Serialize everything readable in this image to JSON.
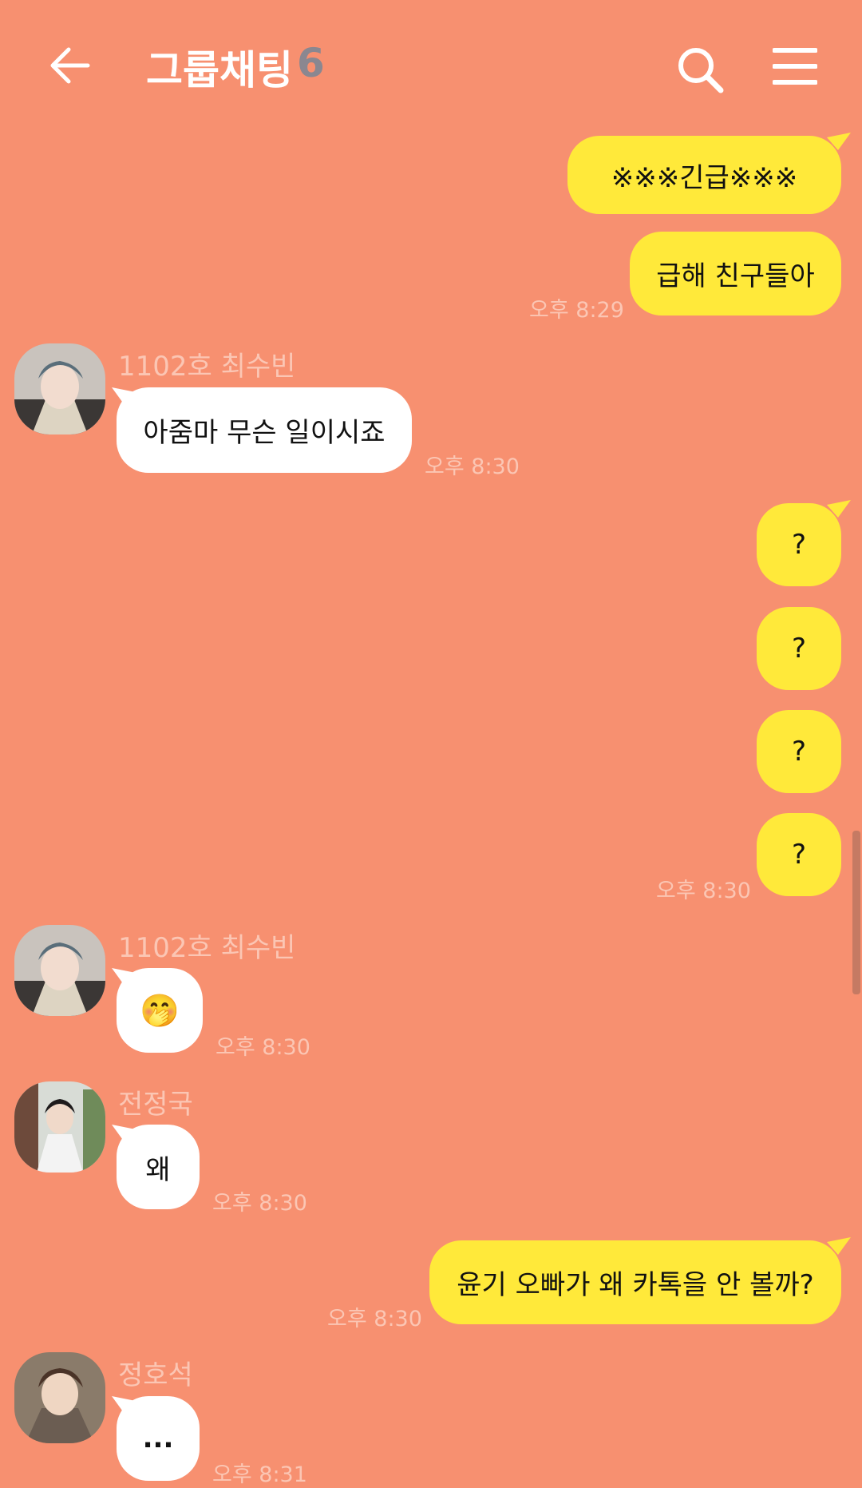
{
  "header": {
    "title": "그룹채팅",
    "member_count": "6",
    "icons": {
      "back": "arrow-left-icon",
      "search": "search-icon",
      "menu": "hamburger-menu-icon"
    }
  },
  "colors": {
    "background": "#f79070",
    "my_bubble": "#ffe93a",
    "their_bubble": "#ffffff",
    "timestamp": "#fbc6b4"
  },
  "messages": [
    {
      "from": "me",
      "text": "※※※긴급※※※"
    },
    {
      "from": "me",
      "text": "급해 친구들아",
      "time": "오후 8:29"
    },
    {
      "from": "1102호 최수빈",
      "text": "아줌마 무슨 일이시죠",
      "time": "오후 8:30"
    },
    {
      "from": "me",
      "text": "?"
    },
    {
      "from": "me",
      "text": "?"
    },
    {
      "from": "me",
      "text": "?"
    },
    {
      "from": "me",
      "text": "?",
      "time": "오후 8:30"
    },
    {
      "from": "1102호 최수빈",
      "text": "🤭",
      "time": "오후 8:30"
    },
    {
      "from": "전정국",
      "text": "왜",
      "time": "오후 8:30"
    },
    {
      "from": "me",
      "text": "윤기 오빠가 왜 카톡을 안 볼까?",
      "time": "오후 8:30"
    },
    {
      "from": "정호석",
      "text": "...",
      "time": "오후 8:31"
    }
  ]
}
